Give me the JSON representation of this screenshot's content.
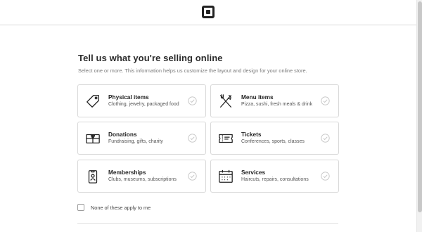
{
  "header": {
    "logo_icon": "square-logo-icon"
  },
  "page": {
    "title": "Tell us what you're selling online",
    "subtitle": "Select one or more. This information helps us customize the layout and design for your online store."
  },
  "options": [
    {
      "label": "Physical items",
      "description": "Clothing, jewelry, packaged food",
      "icon": "tag-icon",
      "selected": false
    },
    {
      "label": "Menu items",
      "description": "Pizza, sushi, fresh meals & drink",
      "icon": "fork-knife-icon",
      "selected": false
    },
    {
      "label": "Donations",
      "description": "Fundraising, gifts, charity",
      "icon": "gift-icon",
      "selected": false
    },
    {
      "label": "Tickets",
      "description": "Conferences, sports, classes",
      "icon": "ticket-icon",
      "selected": false
    },
    {
      "label": "Memberships",
      "description": "Clubs, museums, subscriptions",
      "icon": "id-badge-icon",
      "selected": false
    },
    {
      "label": "Services",
      "description": "Haircuts, repairs, consultations",
      "icon": "calendar-icon",
      "selected": false
    }
  ],
  "none_option": {
    "label": "None of these apply to me",
    "checked": false
  },
  "colors": {
    "border": "#d8d8d8",
    "check": "#c4c4c4",
    "text": "#222222",
    "muted": "#7a7a7a"
  }
}
